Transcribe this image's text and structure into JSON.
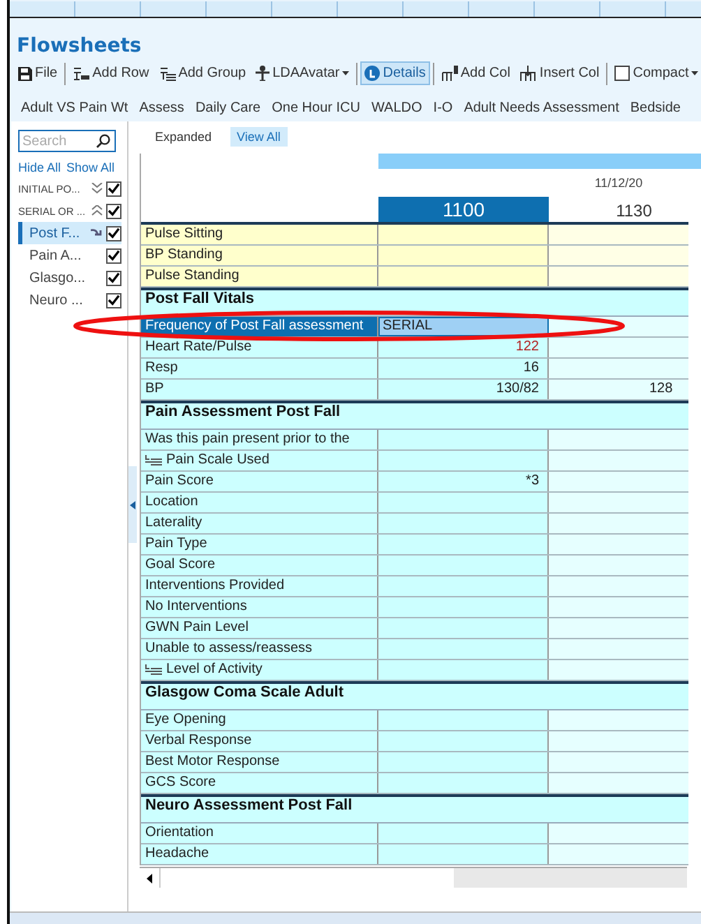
{
  "app": {
    "title": "Flowsheets"
  },
  "toolbar": [
    {
      "label": "File",
      "kind": "save"
    },
    {
      "label": "Add Row",
      "kind": "addrow"
    },
    {
      "label": "Add Group",
      "kind": "addgroup"
    },
    {
      "label": "LDAAvatar",
      "kind": "avatar",
      "dropdown": true
    },
    {
      "label": "Details",
      "kind": "details",
      "active": true
    },
    {
      "label": "Add Col",
      "kind": "addcol"
    },
    {
      "label": "Insert Col",
      "kind": "insertcol"
    },
    {
      "label": "Compact",
      "kind": "checkbox",
      "checked": false,
      "dropdown": true
    }
  ],
  "flowsheet_tabs": [
    "Adult VS Pain Wt",
    "Assess",
    "Daily Care",
    "One Hour ICU",
    "WALDO",
    "I-O",
    "Adult Needs Assessment",
    "Bedside"
  ],
  "sidebar": {
    "search": {
      "placeholder": "Search"
    },
    "links": [
      "Hide All",
      "Show All"
    ],
    "items": [
      {
        "label": "INITIAL PO...",
        "kind": "group",
        "expanded": false,
        "checked": true,
        "selected": false
      },
      {
        "label": "SERIAL OR ...",
        "kind": "group",
        "expanded": true,
        "checked": true,
        "selected": false
      },
      {
        "label": "Post F...",
        "kind": "item",
        "jump": true,
        "checked": true,
        "selected": true
      },
      {
        "label": "Pain A...",
        "kind": "item",
        "checked": true,
        "selected": false
      },
      {
        "label": "Glasgo...",
        "kind": "item",
        "checked": true,
        "selected": false
      },
      {
        "label": "Neuro ...",
        "kind": "item",
        "checked": true,
        "selected": false
      }
    ]
  },
  "view_tabs": [
    {
      "label": "Expanded",
      "selected": false
    },
    {
      "label": "View All",
      "selected": true
    }
  ],
  "grid": {
    "date": "11/12/20",
    "columns": [
      {
        "label": "1100",
        "selected": true
      },
      {
        "label": "1130",
        "selected": false
      }
    ],
    "sections": [
      {
        "color": "#ffffcc",
        "rows": [
          {
            "label": "Pulse Sitting"
          },
          {
            "label": "BP Standing"
          },
          {
            "label": "Pulse Standing"
          }
        ]
      },
      {
        "title": "Post Fall Vitals",
        "color": "#ccffff",
        "rows": [
          {
            "label": "Frequency of Post Fall assessment",
            "value_1": "SERIAL",
            "selected": true
          },
          {
            "label": "Heart Rate/Pulse",
            "value_1": "122",
            "abnormal": true
          },
          {
            "label": "Resp",
            "value_1": "16"
          },
          {
            "label": "BP",
            "value_1": "130/82",
            "value_2": "128"
          }
        ]
      },
      {
        "title": "Pain Assessment Post Fall",
        "color": "#ccffff",
        "rows": [
          {
            "label": "Was this pain present prior to the"
          },
          {
            "label": "Pain Scale Used",
            "icon": true
          },
          {
            "label": "Pain Score",
            "value_1": "*3"
          },
          {
            "label": "Location"
          },
          {
            "label": "Laterality"
          },
          {
            "label": "Pain Type"
          },
          {
            "label": "Goal Score"
          },
          {
            "label": "Interventions Provided"
          },
          {
            "label": "No Interventions"
          },
          {
            "label": "GWN Pain Level"
          },
          {
            "label": "Unable to assess/reassess"
          },
          {
            "label": "Level of Activity",
            "icon": true
          }
        ]
      },
      {
        "title": "Glasgow Coma Scale Adult",
        "color": "#ccffff",
        "rows": [
          {
            "label": "Eye Opening"
          },
          {
            "label": "Verbal Response"
          },
          {
            "label": "Best Motor Response"
          },
          {
            "label": "GCS Score"
          }
        ]
      },
      {
        "title": "Neuro Assessment Post Fall",
        "color": "#ccffff",
        "rows": [
          {
            "label": "Orientation"
          },
          {
            "label": "Headache"
          }
        ]
      }
    ]
  },
  "annotation": {
    "kind": "ellipse",
    "color": "#ee1111"
  }
}
